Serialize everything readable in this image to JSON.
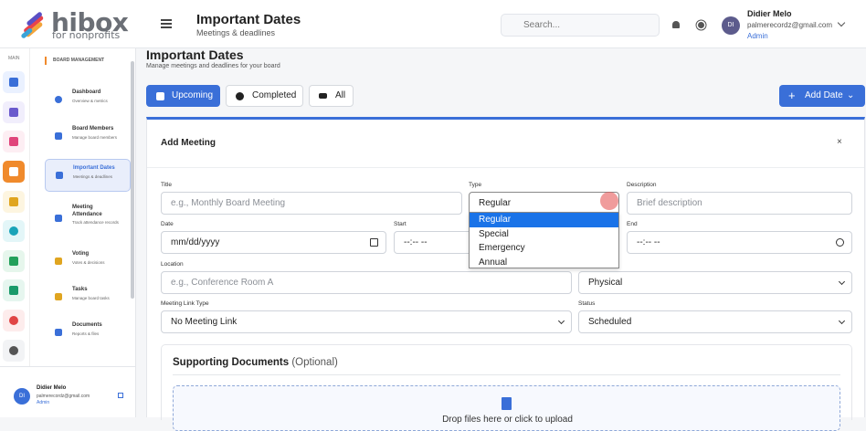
{
  "brand": {
    "name": "hibox",
    "tagline": "for nonprofits"
  },
  "header": {
    "title": "Important Dates",
    "subtitle": "Meetings & deadlines",
    "search_placeholder": "Search...",
    "user": {
      "initials": "DI",
      "name": "Didier Melo",
      "email": "palmerecordz@gmail.com",
      "role": "Admin"
    }
  },
  "rail": {
    "label": "MAIN",
    "icons": [
      "home-icon",
      "org-icon",
      "handshake-icon",
      "calendar-icon",
      "megaphone-icon",
      "globe-icon",
      "network-icon",
      "people-icon",
      "piechart-icon",
      "gear-icon"
    ]
  },
  "sidebar": {
    "section": "BOARD MANAGEMENT",
    "items": [
      {
        "label": "Dashboard",
        "desc": "Overview & metrics"
      },
      {
        "label": "Board Members",
        "desc": "Manage board members"
      },
      {
        "label": "Important Dates",
        "desc": "Meetings & deadlines"
      },
      {
        "label": "Meeting Attendance",
        "desc": "Track attendance records"
      },
      {
        "label": "Voting",
        "desc": "Votes & decisions"
      },
      {
        "label": "Tasks",
        "desc": "Manage board tasks"
      },
      {
        "label": "Documents",
        "desc": "Reports & files"
      }
    ],
    "footer": {
      "initials": "DI",
      "name": "Didier Melo",
      "email": "palmerecordz@gmail.com",
      "role": "Admin"
    }
  },
  "page": {
    "title": "Important Dates",
    "subtitle": "Manage meetings and deadlines for your board"
  },
  "tabs": [
    {
      "label": "Upcoming",
      "active": true
    },
    {
      "label": "Completed",
      "active": false
    },
    {
      "label": "All",
      "active": false
    }
  ],
  "add_button": "Add Date",
  "modal": {
    "title": "Add Meeting",
    "close": "×",
    "fields": {
      "title": {
        "label": "Title",
        "placeholder": "e.g., Monthly Board Meeting"
      },
      "type": {
        "label": "Type",
        "value": "Regular",
        "options": [
          "Regular",
          "Special",
          "Emergency",
          "Annual"
        ]
      },
      "description": {
        "label": "Description",
        "placeholder": "Brief description"
      },
      "date": {
        "label": "Date",
        "value": "mm/dd/yyyy"
      },
      "start": {
        "label": "Start",
        "value": "--:-- --"
      },
      "end": {
        "label": "End",
        "value": "--:-- --"
      },
      "location": {
        "label": "Location",
        "placeholder": "e.g., Conference Room A"
      },
      "format": {
        "value": "Physical"
      },
      "link_type": {
        "label": "Meeting Link Type",
        "value": "No Meeting Link"
      },
      "status": {
        "label": "Status",
        "value": "Scheduled"
      }
    },
    "supporting": {
      "title": "Supporting Documents",
      "optional": "(Optional)",
      "drop": "Drop files here or click to upload"
    }
  },
  "colors": {
    "accent": "#3a6fd8",
    "orange": "#f08a2c"
  }
}
